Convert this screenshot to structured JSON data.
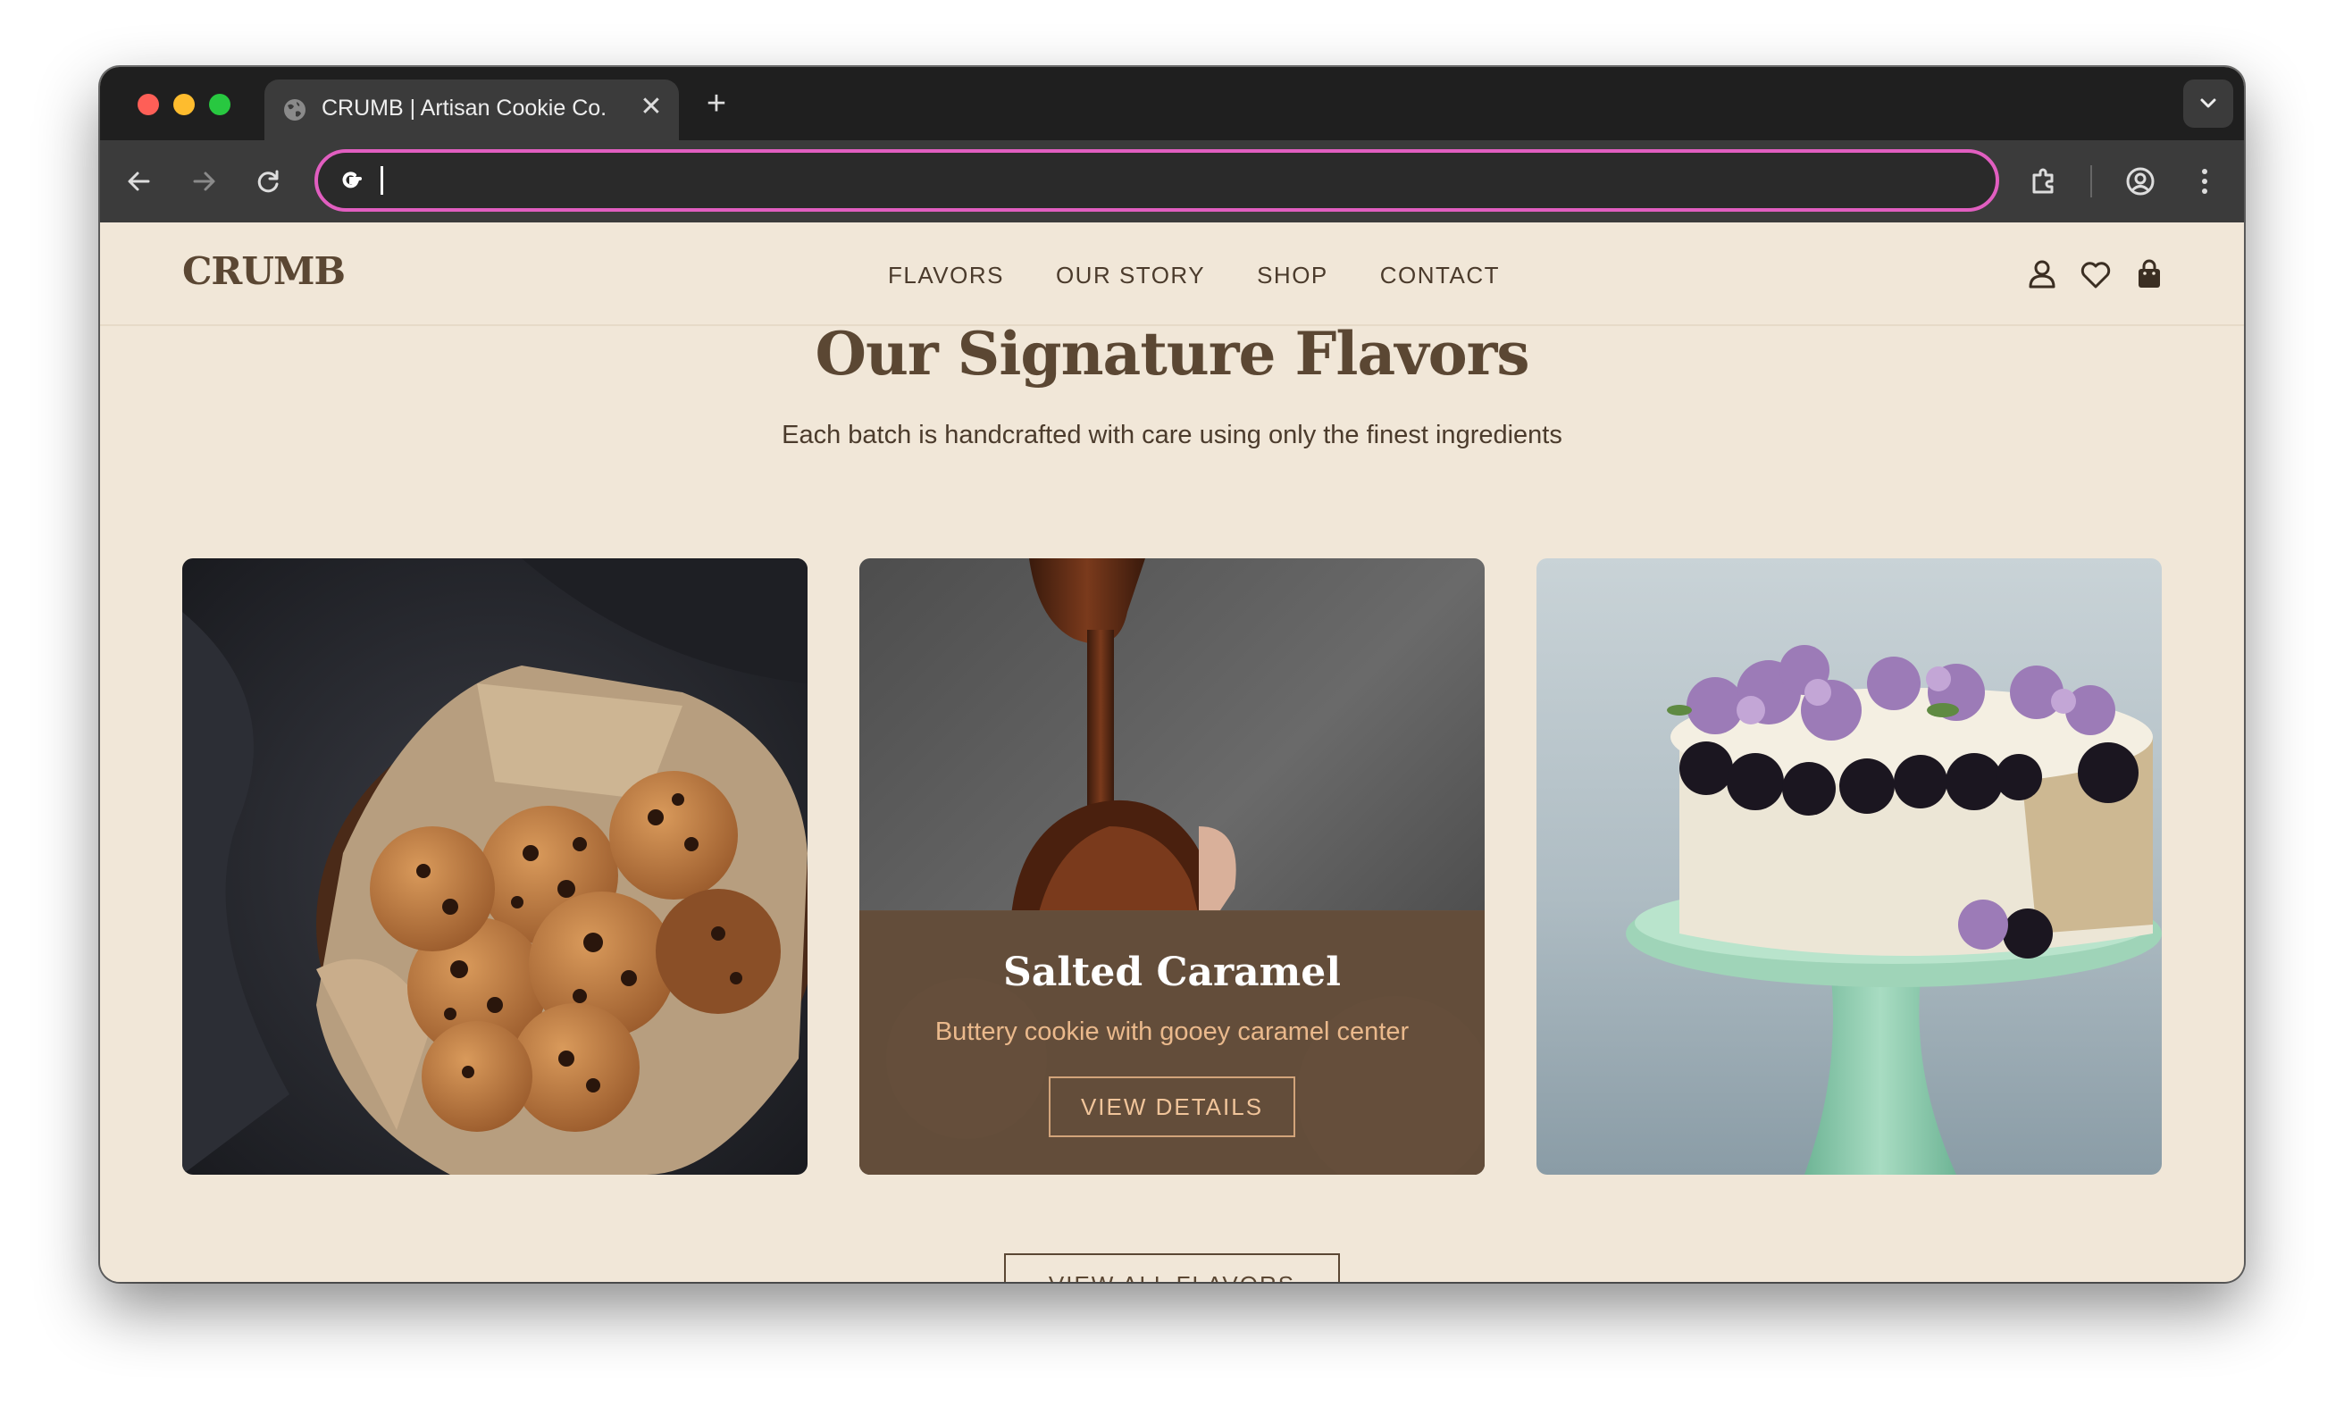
{
  "browser": {
    "tab_title": "CRUMB | Artisan Cookie Co.",
    "tab_close": "✕",
    "new_tab": "+",
    "address_value": "",
    "omnibox_focus_color": "#e15ec0"
  },
  "site": {
    "logo": "CRUMB",
    "nav": [
      "FLAVORS",
      "OUR STORY",
      "SHOP",
      "CONTACT"
    ],
    "icons": [
      "user-icon",
      "heart-icon",
      "shopping-bag-icon"
    ],
    "brand_color": "#5b4733",
    "background_color": "#f1e7d8"
  },
  "section": {
    "title": "Our Signature Flavors",
    "subtitle": "Each batch is handcrafted with care using only the finest ingredients",
    "cards": [
      {
        "image": "chocolate-chip-cookies-in-bowl"
      },
      {
        "image": "chocolate-drizzle",
        "title": "Salted Caramel",
        "description": "Buttery cookie with gooey caramel center",
        "button": "VIEW DETAILS"
      },
      {
        "image": "berry-cake-on-stand"
      }
    ],
    "view_all_button": "VIEW ALL FLAVORS"
  }
}
